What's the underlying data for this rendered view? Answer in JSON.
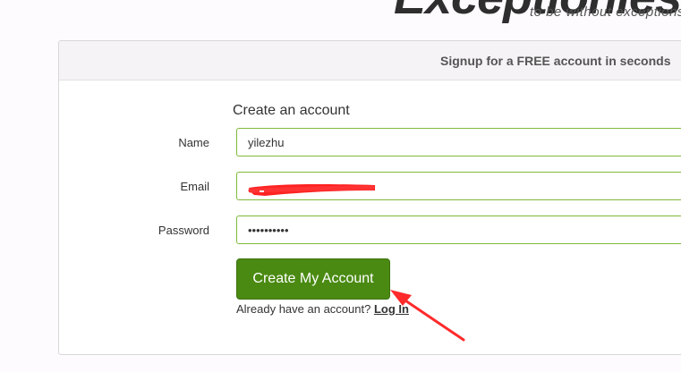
{
  "logo": {
    "wordmark": "Exceptionless",
    "tagline": "to be without exceptions"
  },
  "panel": {
    "header": "Signup for a FREE account in seconds"
  },
  "form": {
    "title": "Create an account",
    "name_label": "Name",
    "name_value": "yilezhu",
    "email_label": "Email",
    "email_value": "",
    "password_label": "Password",
    "password_value": "••••••••••",
    "submit_label": "Create My Account",
    "login_prompt": "Already have an account?",
    "login_link": "Log In"
  },
  "colors": {
    "input_border": "#7fb93a",
    "button": "#4a8a12",
    "annotation": "#ff2b2b"
  }
}
